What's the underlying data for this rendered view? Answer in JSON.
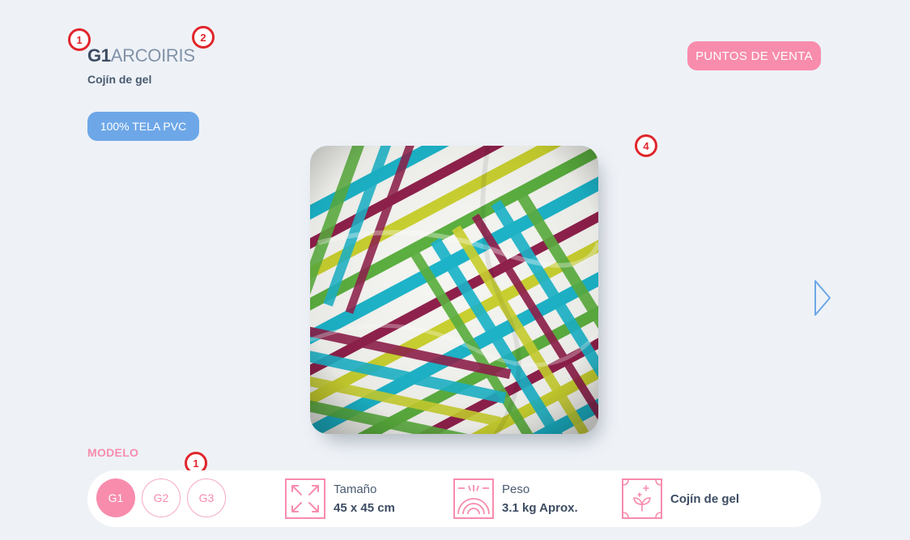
{
  "product": {
    "code": "G1",
    "name": "ARCOIRIS",
    "subtitle": "Cojín de gel",
    "material_badge": "100% TELA PVC"
  },
  "header": {
    "puntos_label": "PUNTOS DE VENTA"
  },
  "markers": {
    "m1": "1",
    "m2": "2",
    "m3": "1",
    "m4": "4"
  },
  "modelo": {
    "label": "MODELO",
    "options": [
      {
        "label": "G1",
        "active": true
      },
      {
        "label": "G2",
        "active": false
      },
      {
        "label": "G3",
        "active": false
      }
    ]
  },
  "specs": {
    "size_label": "Tamaño",
    "size_value": "45 x 45 cm",
    "weight_label": "Peso",
    "weight_value": "3.1 kg Aprox.",
    "type_value": "Cojín de gel"
  },
  "icons": {
    "size": "expand-arrows-icon",
    "weight": "scale-gauge-icon",
    "type": "leaf-sparkle-icon",
    "next": "chevron-right-icon"
  },
  "colors": {
    "accent_pink": "#f88cad",
    "badge_blue": "#6da7e8",
    "background": "#eef2f7",
    "text_dark": "#3c4c63",
    "marker_red": "#e0262c"
  }
}
